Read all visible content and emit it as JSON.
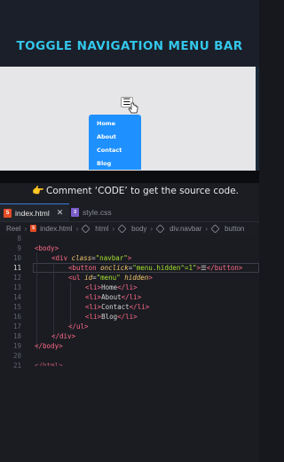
{
  "banner": {
    "title": "TOGGLE NAVIGATION MENU BAR"
  },
  "preview": {
    "toggle_label": "☰",
    "menu_items": [
      "Home",
      "About",
      "Contact",
      "Blog"
    ]
  },
  "hint": {
    "emoji": "👉",
    "text": "Comment ‘CODE’ to get the source code."
  },
  "tabs": [
    {
      "label": "index.html",
      "icon": "html5-icon",
      "active": true
    },
    {
      "label": "style.css",
      "icon": "css3-icon",
      "active": false
    }
  ],
  "breadcrumb": [
    "Reel",
    "index.html",
    "html",
    "body",
    "div.navbar",
    "button"
  ],
  "editor": {
    "line_numbers": [
      "8",
      "9",
      "10",
      "11",
      "12",
      "13",
      "14",
      "15",
      "16",
      "17",
      "18",
      "19",
      "20",
      "21"
    ],
    "active_line": "11"
  },
  "colors": {
    "accent": "#33c6ea",
    "menu": "#1e90ff",
    "tag": "#ff6b87",
    "attr": "#f3c86b",
    "string": "#a6e22e"
  }
}
